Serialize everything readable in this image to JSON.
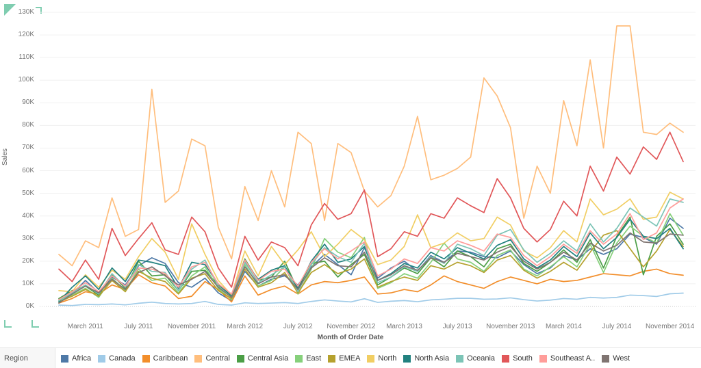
{
  "chart_data": {
    "type": "line",
    "title": "",
    "xlabel": "Month of Order Date",
    "ylabel": "Sales",
    "ylim": [
      0,
      130000
    ],
    "ytick_labels": [
      "0K",
      "10K",
      "20K",
      "30K",
      "40K",
      "50K",
      "60K",
      "70K",
      "80K",
      "90K",
      "100K",
      "110K",
      "120K",
      "130K"
    ],
    "ytick_values": [
      0,
      10000,
      20000,
      30000,
      40000,
      50000,
      60000,
      70000,
      80000,
      90000,
      100000,
      110000,
      120000,
      130000
    ],
    "grid": true,
    "legend_position": "bottom",
    "legend_title": "Region",
    "x": [
      "January 2011",
      "February 2011",
      "March 2011",
      "April 2011",
      "May 2011",
      "June 2011",
      "July 2011",
      "August 2011",
      "September 2011",
      "October 2011",
      "November 2011",
      "December 2011",
      "January 2012",
      "February 2012",
      "March 2012",
      "April 2012",
      "May 2012",
      "June 2012",
      "July 2012",
      "August 2012",
      "September 2012",
      "October 2012",
      "November 2012",
      "December 2012",
      "January 2013",
      "February 2013",
      "March 2013",
      "April 2013",
      "May 2013",
      "June 2013",
      "July 2013",
      "August 2013",
      "September 2013",
      "October 2013",
      "November 2013",
      "December 2013",
      "January 2014",
      "February 2014",
      "March 2014",
      "April 2014",
      "May 2014",
      "June 2014",
      "July 2014",
      "August 2014",
      "September 2014",
      "October 2014",
      "November 2014",
      "December 2014"
    ],
    "xtick_labels": [
      "March 2011",
      "July 2011",
      "November 2011",
      "March 2012",
      "July 2012",
      "November 2012",
      "March 2013",
      "July 2013",
      "November 2013",
      "March 2014",
      "July 2014",
      "November 2014"
    ],
    "xtick_indices": [
      2,
      6,
      10,
      14,
      18,
      22,
      26,
      30,
      34,
      38,
      42,
      46
    ],
    "series": [
      {
        "name": "Africa",
        "color": "#4e79a7",
        "values": [
          3000,
          5500,
          11500,
          6000,
          13000,
          9500,
          18000,
          21500,
          19000,
          10500,
          8500,
          12500,
          6000,
          2500,
          15500,
          9000,
          12000,
          13500,
          9500,
          17500,
          23000,
          18500,
          14000,
          26000,
          12500,
          17000,
          20000,
          15500,
          22500,
          19500,
          24500,
          24000,
          22000,
          21500,
          24500,
          18500,
          14500,
          17000,
          22500,
          20500,
          25500,
          23000,
          25500,
          32000,
          30500,
          27500,
          39000,
          34500
        ]
      },
      {
        "name": "Canada",
        "color": "#a0cbe8",
        "values": [
          600,
          400,
          900,
          800,
          1100,
          700,
          1400,
          1900,
          1300,
          1100,
          1300,
          2200,
          900,
          600,
          1600,
          1300,
          1500,
          1700,
          1300,
          2200,
          2900,
          2400,
          2000,
          3400,
          1800,
          2300,
          2600,
          2100,
          2900,
          3200,
          3600,
          3600,
          3200,
          3300,
          3800,
          3000,
          2400,
          2800,
          3500,
          3200,
          4000,
          3700,
          4000,
          5000,
          4800,
          4400,
          5600,
          5900
        ]
      },
      {
        "name": "Caribbean",
        "color": "#f28e2b",
        "values": [
          1500,
          3500,
          6500,
          5500,
          9500,
          7500,
          14000,
          10500,
          9000,
          3500,
          4500,
          11000,
          7500,
          2000,
          13500,
          5000,
          7500,
          9000,
          5500,
          9500,
          11000,
          10500,
          11500,
          13000,
          5500,
          6000,
          7500,
          6500,
          9500,
          13500,
          11000,
          9500,
          8000,
          11000,
          13000,
          11500,
          10000,
          12000,
          11000,
          11500,
          13000,
          14500,
          14000,
          13500,
          15500,
          16500,
          14500,
          13800
        ]
      },
      {
        "name": "Central",
        "color": "#ffbe7d",
        "values": [
          23000,
          18000,
          29000,
          26000,
          48000,
          31000,
          34000,
          96000,
          46000,
          51000,
          74000,
          71000,
          35000,
          21000,
          53000,
          38000,
          60000,
          44000,
          77000,
          72000,
          38000,
          72000,
          68000,
          51000,
          44000,
          49000,
          62000,
          84000,
          56000,
          58000,
          61000,
          66000,
          101000,
          93000,
          79000,
          39000,
          62000,
          50000,
          91000,
          71000,
          109000,
          70000,
          124000,
          124000,
          77000,
          76000,
          81000,
          77000
        ]
      },
      {
        "name": "Central Asia",
        "color": "#4b9e46"
      },
      {
        "name": "East",
        "color": "#86d07b"
      },
      {
        "name": "EMEA",
        "color": "#b5a12e"
      },
      {
        "name": "North",
        "color": "#f1ce63"
      },
      {
        "name": "North Asia",
        "color": "#21817f"
      },
      {
        "name": "Oceania",
        "color": "#7cc4b6"
      },
      {
        "name": "South",
        "color": "#e15759"
      },
      {
        "name": "Southeast A..",
        "color": "#ff9d9a"
      },
      {
        "name": "West",
        "color": "#7f7471"
      }
    ]
  },
  "axes": {
    "y_title": "Sales",
    "x_title": "Month of Order Date"
  },
  "legend": {
    "title": "Region",
    "items": [
      {
        "label": "Africa",
        "color": "#4e79a7"
      },
      {
        "label": "Canada",
        "color": "#a0cbe8"
      },
      {
        "label": "Caribbean",
        "color": "#f28e2b"
      },
      {
        "label": "Central",
        "color": "#ffbe7d"
      },
      {
        "label": "Central Asia",
        "color": "#4b9e46"
      },
      {
        "label": "East",
        "color": "#86d07b"
      },
      {
        "label": "EMEA",
        "color": "#b5a12e"
      },
      {
        "label": "North",
        "color": "#f1ce63"
      },
      {
        "label": "North Asia",
        "color": "#21817f"
      },
      {
        "label": "Oceania",
        "color": "#7cc4b6"
      },
      {
        "label": "South",
        "color": "#e15759"
      },
      {
        "label": "Southeast A..",
        "color": "#ff9d9a"
      },
      {
        "label": "West",
        "color": "#7f7471"
      }
    ]
  },
  "series_values": {
    "Central Asia": [
      3500,
      7000,
      9000,
      5000,
      14000,
      8000,
      20000,
      13500,
      14000,
      7000,
      15500,
      16000,
      9500,
      4500,
      21000,
      11500,
      13000,
      20000,
      7000,
      19000,
      20000,
      13000,
      18500,
      23000,
      9500,
      13000,
      17000,
      14500,
      21500,
      17500,
      24500,
      22000,
      17500,
      25500,
      27500,
      19000,
      15500,
      19500,
      25000,
      19500,
      29500,
      17000,
      31000,
      39500,
      14000,
      31000,
      36500,
      27500
    ],
    "East": [
      2500,
      5000,
      8000,
      4000,
      12500,
      7000,
      16500,
      11500,
      12500,
      6000,
      13500,
      17500,
      8000,
      3000,
      18500,
      9000,
      11500,
      17500,
      5500,
      16500,
      30000,
      24000,
      21500,
      30500,
      8000,
      10500,
      14500,
      12500,
      19500,
      28000,
      21000,
      19500,
      15500,
      22500,
      25000,
      16500,
      13500,
      17500,
      22000,
      17500,
      27500,
      15000,
      28000,
      35500,
      31000,
      28000,
      41000,
      31500
    ],
    "EMEA": [
      2000,
      4500,
      7500,
      4500,
      11500,
      6500,
      15500,
      12500,
      11000,
      5500,
      12500,
      14500,
      7000,
      3500,
      16500,
      8500,
      10500,
      15000,
      6000,
      15000,
      18500,
      14500,
      16500,
      21000,
      8500,
      11000,
      13000,
      11500,
      18000,
      16500,
      19500,
      18000,
      15000,
      20500,
      22500,
      16000,
      12500,
      15500,
      19500,
      16000,
      24000,
      31500,
      33500,
      25500,
      17500,
      24500,
      34000,
      26500
    ],
    "North": [
      7000,
      6500,
      14000,
      8500,
      16000,
      12000,
      22000,
      30000,
      24000,
      12000,
      36500,
      23000,
      11500,
      5000,
      24500,
      13500,
      26500,
      18500,
      25000,
      33000,
      22000,
      27500,
      34000,
      29500,
      18500,
      20500,
      26500,
      40500,
      26000,
      28000,
      32500,
      29000,
      30000,
      39500,
      36000,
      24500,
      21500,
      26000,
      33500,
      28500,
      47500,
      40500,
      43000,
      47500,
      38500,
      39500,
      50500,
      47500
    ],
    "North Asia": [
      2000,
      8500,
      13500,
      7500,
      17000,
      11000,
      20500,
      19500,
      18000,
      8000,
      19500,
      18500,
      10000,
      4500,
      20000,
      12000,
      16000,
      18000,
      8000,
      20000,
      27500,
      19500,
      21000,
      26500,
      11500,
      14500,
      19000,
      17000,
      24000,
      21000,
      26000,
      23500,
      21000,
      27000,
      29500,
      21000,
      17000,
      20500,
      26500,
      22000,
      32500,
      25500,
      30500,
      38500,
      31000,
      30000,
      34500,
      25500
    ],
    "Oceania": [
      2500,
      6000,
      9500,
      5500,
      14500,
      8500,
      18500,
      15500,
      15000,
      7000,
      16500,
      20500,
      9000,
      4000,
      19500,
      10500,
      14000,
      17500,
      6500,
      18500,
      26000,
      22000,
      19500,
      28000,
      10500,
      13000,
      17500,
      15500,
      22000,
      19000,
      27500,
      25500,
      22500,
      31500,
      34000,
      25000,
      19500,
      23500,
      29000,
      24500,
      36500,
      28500,
      34500,
      43500,
      39500,
      35500,
      47500,
      46000
    ],
    "South": [
      16500,
      11000,
      20500,
      12000,
      34500,
      22500,
      30000,
      37000,
      25000,
      23000,
      39500,
      33000,
      17000,
      8500,
      31000,
      20500,
      28500,
      26000,
      18000,
      36000,
      45500,
      38500,
      41000,
      51500,
      22000,
      25500,
      33000,
      31000,
      41000,
      39000,
      48000,
      44500,
      41500,
      56500,
      48000,
      34500,
      28500,
      34000,
      46500,
      40000,
      62000,
      51000,
      66000,
      58500,
      70500,
      65000,
      77000,
      64000
    ],
    "Southeast A..": [
      3000,
      6500,
      10500,
      6500,
      13500,
      9000,
      17000,
      16500,
      14500,
      8500,
      17500,
      19500,
      10000,
      5500,
      20500,
      11500,
      15500,
      16500,
      9000,
      19500,
      25500,
      21000,
      24500,
      28500,
      13500,
      16500,
      21000,
      19000,
      26000,
      24500,
      29000,
      27000,
      24500,
      32000,
      30500,
      22500,
      18000,
      22000,
      27500,
      23500,
      33500,
      27500,
      32000,
      41000,
      29500,
      32500,
      43500,
      47500
    ],
    "West": [
      1500,
      5500,
      9000,
      6000,
      12000,
      7500,
      15000,
      17500,
      13500,
      9500,
      12000,
      15500,
      8500,
      4000,
      17500,
      10000,
      13000,
      14000,
      7500,
      17000,
      21500,
      18000,
      17500,
      24000,
      11500,
      14000,
      18000,
      16000,
      21500,
      19500,
      23500,
      22000,
      20500,
      24000,
      26500,
      20000,
      16500,
      19500,
      24000,
      20500,
      28000,
      24500,
      27000,
      32500,
      28500,
      28000,
      32000,
      31500
    ]
  }
}
